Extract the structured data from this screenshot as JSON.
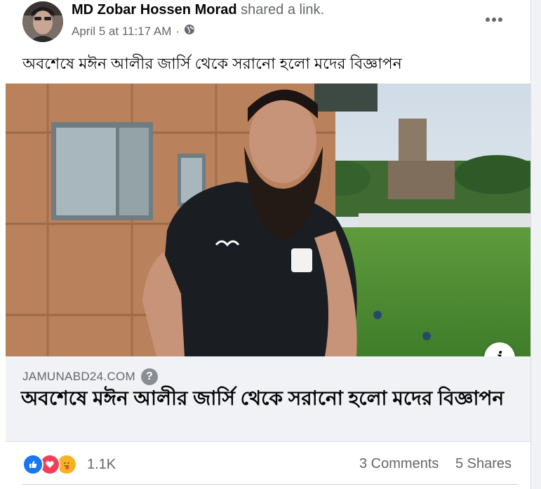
{
  "post": {
    "author_name": "MD Zobar Hossen Morad",
    "action_text": "shared a link.",
    "date": "April 5 at 11:17 AM",
    "separator": "·",
    "privacy_icon": "globe-icon",
    "more_icon": "more-horizontal-icon",
    "text": "অবশেষে মঈন আলীর জার্সি থেকে সরানো হলো মদের বিজ্ঞাপন"
  },
  "link_preview": {
    "image_icon": "info-icon",
    "info_label": "i",
    "domain": "JAMUNABD24.COM",
    "help_label": "?",
    "title": "অবশেষে মঈন আলীর জার্সি থেকে সরানো হলো মদের বিজ্ঞাপন"
  },
  "footer": {
    "reactions": [
      "like",
      "love",
      "care"
    ],
    "reaction_count": "1.1K",
    "comments": "3 Comments",
    "shares": "5 Shares"
  },
  "colors": {
    "like": "#1877f2",
    "love": "#f33e58",
    "care": "#f7b125",
    "secondary_text": "#65676b",
    "primary_text": "#050505",
    "link_box_bg": "#f0f2f5"
  }
}
